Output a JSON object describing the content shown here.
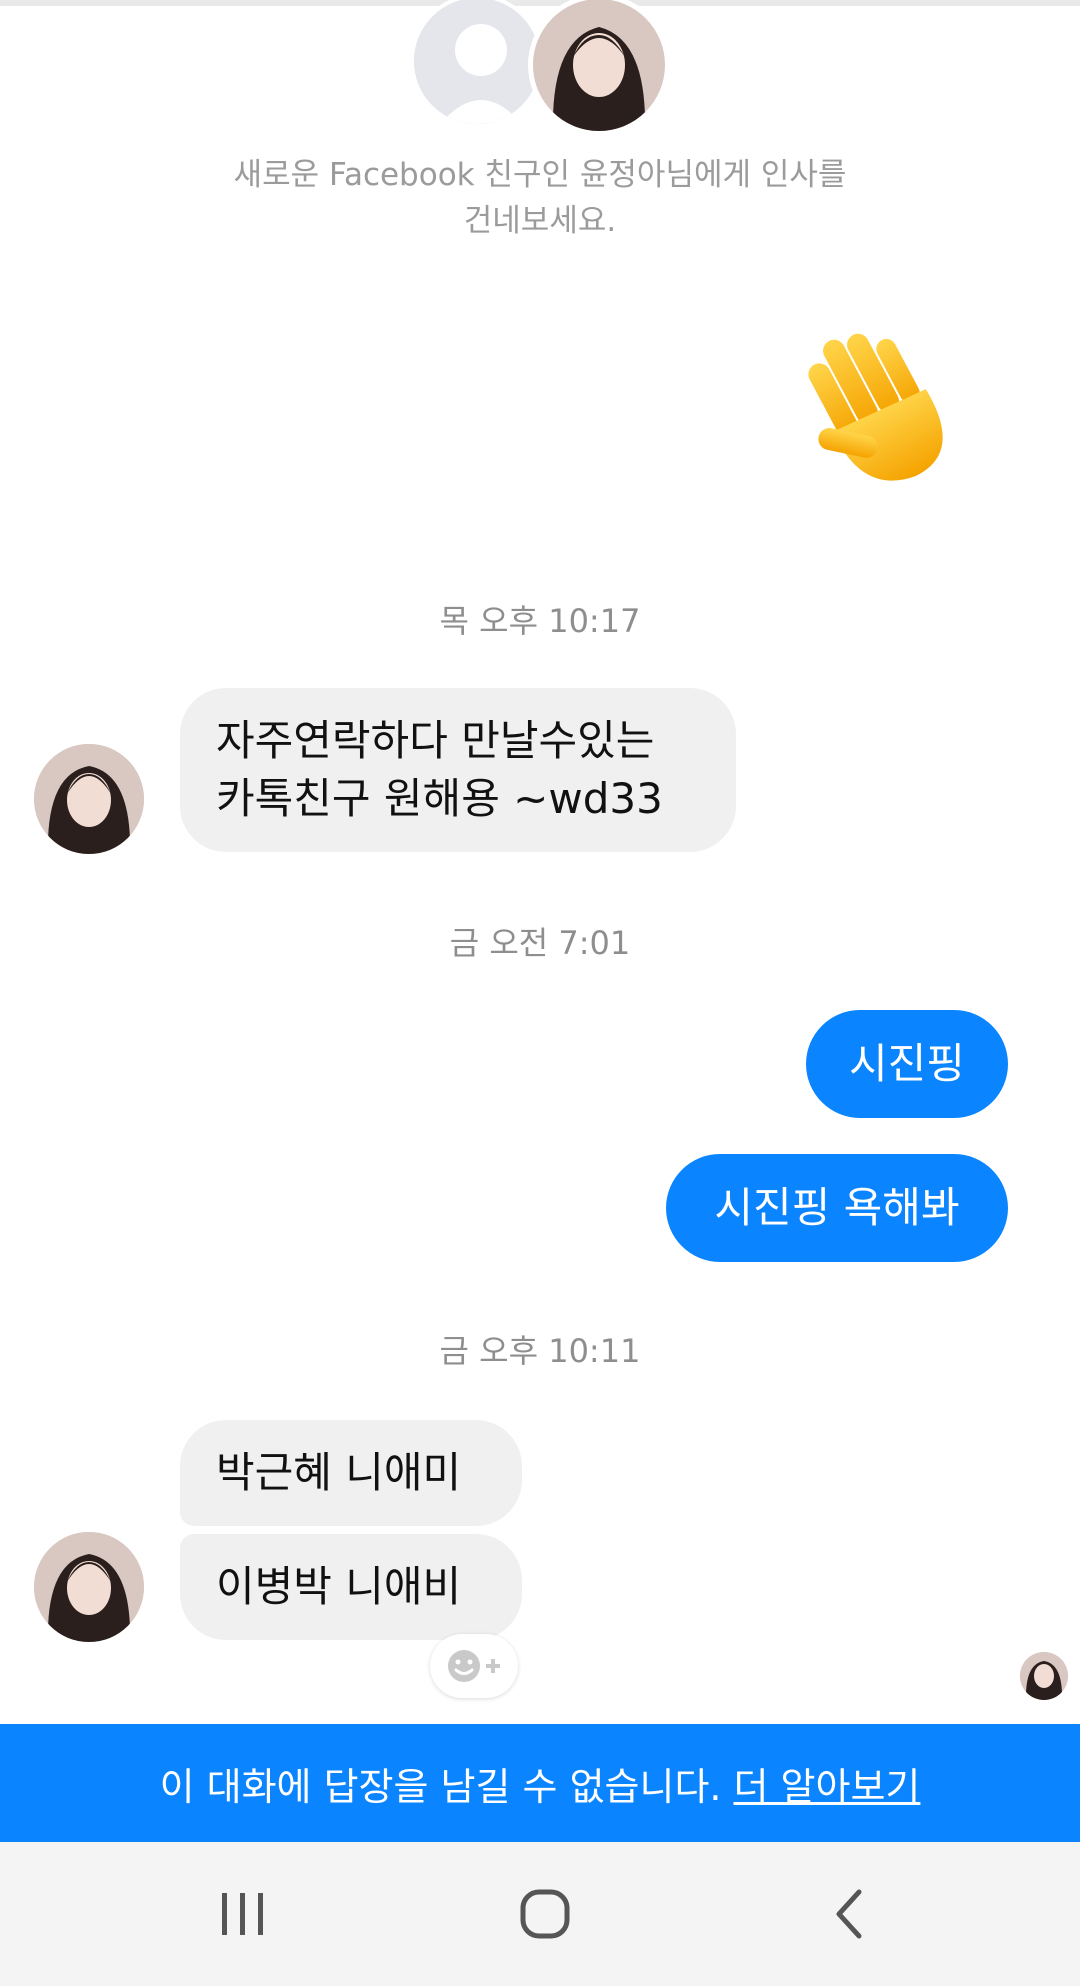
{
  "header": {
    "intro_line1": "새로운 Facebook 친구인 윤정아님에게 인사를",
    "intro_line2": "건네보세요."
  },
  "icons": {
    "wave": "waving-hand-icon",
    "reaction": "smiley-plus-icon",
    "nav_recent": "recent-apps-icon",
    "nav_home": "home-icon",
    "nav_back": "back-icon"
  },
  "messages": {
    "ts1": "목 오후 10:17",
    "in1_line1": "자주연락하다 만날수있는",
    "in1_line2": "카톡친구 원해용 ~wd33",
    "ts2": "금 오전 7:01",
    "out1": "시진핑",
    "out2": "시진핑 욕해봐",
    "ts3": "금 오후 10:11",
    "in2": "박근혜 니애미",
    "in3": "이병박 니애비"
  },
  "banner": {
    "text": "이 대화에 답장을 남길 수 없습니다.",
    "link": "더 알아보기"
  },
  "colors": {
    "accent": "#0a84ff",
    "incoming_bubble": "#f0f0f0",
    "timestamp": "#8e8e8e"
  }
}
